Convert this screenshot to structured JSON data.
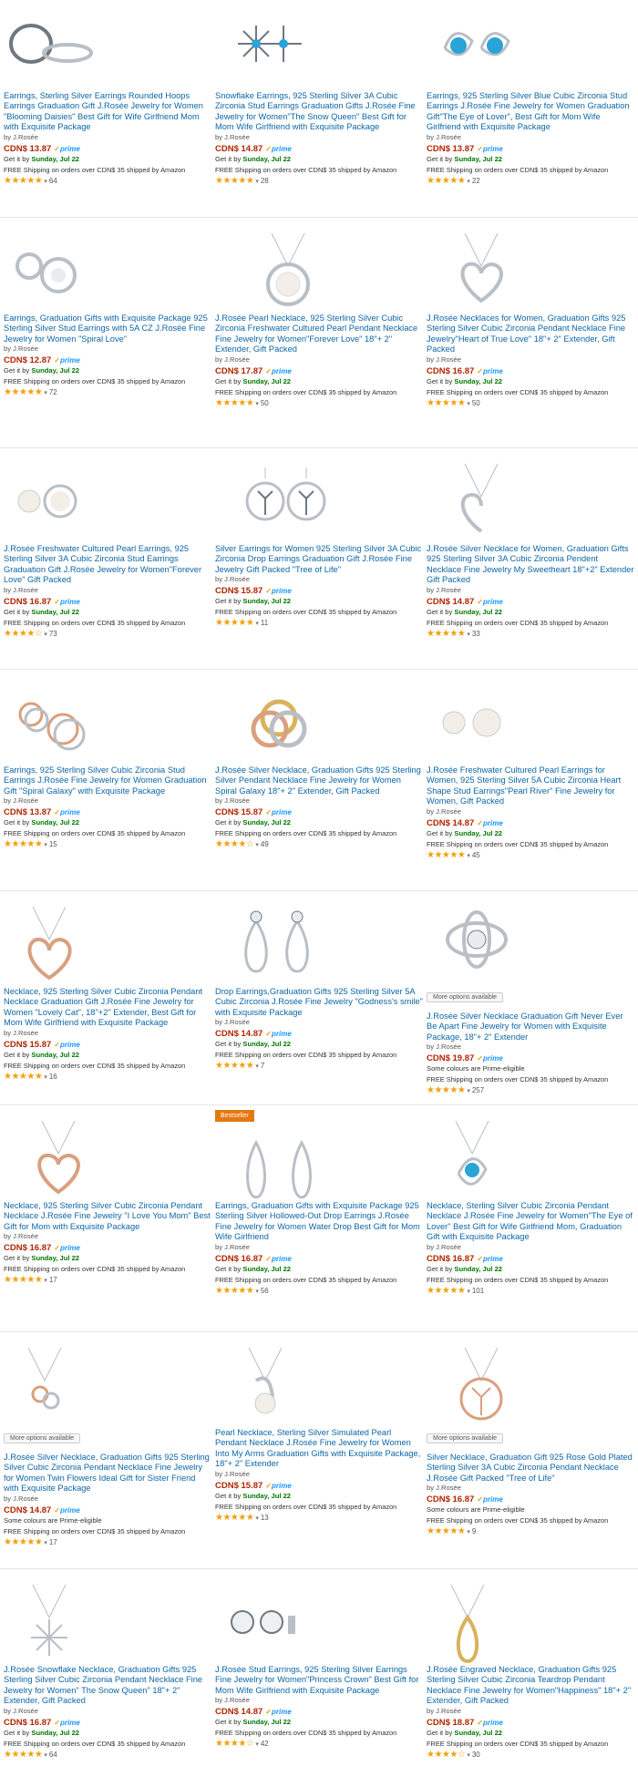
{
  "shared": {
    "by": "by J.Rosée",
    "prime": "prime",
    "get_it_prefix": "Get it by",
    "delivery_date": "Sunday, Jul 22",
    "colours_note": "Some colours are Prime-eligible",
    "shipping": "FREE Shipping on orders over CDN$ 35 shipped by Amazon",
    "more_options": "More options available",
    "bestseller": "Bestseller",
    "star_color": "#f59e0b",
    "link_color": "#0b66a8",
    "price_color": "#b12704"
  },
  "products": [
    {
      "icon": "hoop-earrings",
      "title": "Earrings, Sterling Silver Earrings Rounded Hoops Earrings Graduation Gift J.Rosée Jewelry for Women \"Blooming Daisies\" Best Gift for Wife Girlfriend Mom with Exquisite Package",
      "price": "CDN$ 13.87",
      "stars": "★★★★★",
      "rating": 4.5,
      "reviews": "64",
      "delivery": true
    },
    {
      "icon": "snowflake-earrings",
      "title": "Snowflake Earrings, 925 Sterling Silver 3A Cubic Zirconia Stud Earrings Graduation Gifts J.Rosée Fine Jewelry for Women\"The Snow Queen\" Best Gift for Mom Wife Girlfriend with Exquisite Package",
      "price": "CDN$ 14.87",
      "stars": "★★★★★",
      "rating": 4.5,
      "reviews": "28",
      "delivery": true
    },
    {
      "icon": "blue-zirconia-earrings",
      "title": "Earrings, 925 Sterling Silver Blue Cubic Zirconia Stud Earrings J.Rosée Fine Jewelry for Women Graduation Gift\"The Eye of Lover\", Best Gift for Mom Wife Girlfriend with Exquisite Package",
      "price": "CDN$ 13.87",
      "stars": "★★★★★",
      "rating": 4.5,
      "reviews": "22",
      "delivery": true
    },
    {
      "icon": "swirl-stud-earrings",
      "title": "Earrings, Graduation Gifts with Exquisite Package 925 Sterling Silver Stud Earrings with 5A CZ J.Rosée Fine Jewelry for Women \"Spiral Love\"",
      "price": "CDN$ 12.87",
      "stars": "★★★★★",
      "rating": 4.5,
      "reviews": "72",
      "delivery": true
    },
    {
      "icon": "pearl-pendant",
      "title": "J.Rosée Pearl Necklace, 925 Sterling Silver Cubic Zirconia Freshwater Cultured Pearl Pendant Necklace Fine Jewelry for Women\"Forever Love\" 18\"+ 2\" Extender, Gift Packed",
      "price": "CDN$ 17.87",
      "stars": "★★★★★",
      "rating": 4.5,
      "reviews": "50",
      "delivery": true
    },
    {
      "icon": "heart-pendant",
      "title": "J.Rosée Necklaces for Women, Graduation Gifts 925 Sterling Silver Cubic Zirconia Pendant Necklace Fine Jewelry\"Heart of True Love\" 18\"+ 2\" Extender, Gift Packed",
      "price": "CDN$ 16.87",
      "stars": "★★★★★",
      "rating": 4.5,
      "reviews": "50",
      "delivery": true
    },
    {
      "icon": "pearl-stud-earrings",
      "title": "J.Rosée Freshwater Cultured Pearl Earrings, 925 Sterling Silver 3A Cubic Zirconia Stud Earrings Graduation Gift J.Rosée Jewelry for Women\"Forever Love\" Gift Packed",
      "price": "CDN$ 16.87",
      "stars": "★★★★☆",
      "rating": 4,
      "reviews": "73",
      "delivery": true
    },
    {
      "icon": "tree-drop-earrings",
      "title": "Silver Earrings for Women 925 Sterling Silver 3A Cubic Zirconia Drop Earrings Graduation Gift J.Rosée Fine Jewelry Gift Packed \"Tree of Life\"",
      "price": "CDN$ 15.87",
      "stars": "★★★★★",
      "rating": 4.5,
      "reviews": "11",
      "delivery": true
    },
    {
      "icon": "heart-outline-pendant",
      "title": "J.Rosée Silver Necklace for Women, Graduation Gifts 925 Sterling Silver 3A Cubic Zirconia Pendent Necklace Fine Jewelry My Sweetheart 18\"+2\" Extender Gift Packed",
      "price": "CDN$ 14.87",
      "stars": "★★★★★",
      "rating": 4.5,
      "reviews": "33",
      "delivery": true
    },
    {
      "icon": "knot-stud-earrings",
      "title": "Earrings, 925 Sterling Silver Cubic Zirconia Stud Earrings J.Rosée Fine Jewelry for Women Graduation Gift \"Spiral Galaxy\" with Exquisite Package",
      "price": "CDN$ 13.87",
      "stars": "★★★★★",
      "rating": 5,
      "reviews": "15",
      "delivery": true
    },
    {
      "icon": "tricolor-knot-pendant",
      "title": "J.Rosée Silver Necklace, Graduation Gifts 925 Sterling Silver Pendant Necklace Fine Jewelry for Women Spiral Galaxy 18\"+ 2\" Extender, Gift Packed",
      "price": "CDN$ 15.87",
      "stars": "★★★★☆",
      "rating": 4,
      "reviews": "49",
      "delivery": true
    },
    {
      "icon": "pearl-heart-earrings",
      "title": "J.Rosée Freshwater Cultured Pearl Earrings for Women, 925 Sterling Silver 5A Cubic Zirconia Heart Shape Stud Earrings\"Pearl River\" Fine Jewelry for Women, Gift Packed",
      "price": "CDN$ 14.87",
      "stars": "★★★★★",
      "rating": 4.5,
      "reviews": "45",
      "delivery": true
    },
    {
      "icon": "rose-heart-pendant",
      "title": "Necklace, 925 Sterling Silver Cubic Zirconia Pendant Necklace Graduation Gift J.Rosée Fine Jewelry for Women \"Lovely Cat\", 18\"+2\" Extender, Best Gift for Mom Wife Girlfriend with Exquisite Package",
      "price": "CDN$ 15.87",
      "stars": "★★★★★",
      "rating": 4.5,
      "reviews": "16",
      "delivery": true
    },
    {
      "icon": "teardrop-earrings",
      "title": "Drop Earrings,Graduation Gifts 925 Sterling Silver 5A Cubic Zirconia J.Rosée Fine Jewelry \"Godness's smile\" with Exquisite Package",
      "price": "CDN$ 14.87",
      "stars": "★★★★★",
      "rating": 5,
      "reviews": "7",
      "delivery": true
    },
    {
      "icon": "orbit-pendant",
      "title": "J.Rosée Silver Necklace Graduation Gift Never Ever Be Apart Fine Jewelry for Women with Exquisite Package, 18\"+ 2\" Extender",
      "price": "CDN$ 19.87",
      "stars": "★★★★★",
      "rating": 4.5,
      "reviews": "257",
      "delivery": false,
      "colours": true,
      "more_options": true
    },
    {
      "icon": "i-love-you-mom-pendant",
      "title": "Necklace, 925 Sterling Silver Cubic Zirconia Pendant Necklace J.Rosée Fine Jewelry \"I Love You Mom\" Best Gift for Mom with Exquisite Package",
      "price": "CDN$ 16.87",
      "stars": "★★★★★",
      "rating": 4.5,
      "reviews": "17",
      "delivery": true
    },
    {
      "icon": "hollow-drop-earrings",
      "title": "Earrings, Graduation Gifts with Exquisite Package 925 Sterling Silver Hollowed-Out Drop Earrings J.Rosée Fine Jewelry for Women Water Drop Best Gift for Mom Wife Girlfriend",
      "price": "CDN$ 16.87",
      "stars": "★★★★★",
      "rating": 4.5,
      "reviews": "56",
      "delivery": true,
      "bestseller": true
    },
    {
      "icon": "blue-eye-pendant",
      "title": "Necklace, Sterling Silver Cubic Zirconia Pendant Necklace J.Rosée Fine Jewelry for Women\"The Eye of Lover\" Best Gift for Wife Girlfriend Mom, Graduation Gift with Exquisite Package",
      "price": "CDN$ 16.87",
      "stars": "★★★★★",
      "rating": 4.5,
      "reviews": "101",
      "delivery": true
    },
    {
      "icon": "twin-flowers-pendant",
      "title": "J.Rosée Silver Necklace, Graduation Gifts 925 Sterling Silver Cubic Zirconia Pendant Necklace Fine Jewelry for Women Twin Flowers Ideal Gift for Sister Friend with Exquisite Package",
      "price": "CDN$ 14.87",
      "stars": "★★★★★",
      "rating": 4.5,
      "reviews": "17",
      "delivery": false,
      "colours": true,
      "more_options": true
    },
    {
      "icon": "pearl-wing-pendant",
      "title": "Pearl Necklace, Sterling Silver Simulated Pearl Pendant Necklace J.Rosée Fine Jewelry for Women Into My Arms Graduation Gifts with Exquisite Package, 18\"+ 2\" Extender",
      "price": "CDN$ 15.87",
      "stars": "★★★★★",
      "rating": 4.5,
      "reviews": "13",
      "delivery": true
    },
    {
      "icon": "rose-tree-pendant",
      "title": "Silver Necklace, Graduation Gift 925 Rose Gold Plated Sterling Silver 3A Cubic Zirconia Pendant Necklace J.Rosée Gift Packed \"Tree of Life\"",
      "price": "CDN$ 16.87",
      "stars": "★★★★★",
      "rating": 4.5,
      "reviews": "9",
      "delivery": false,
      "colours": true,
      "more_options": true
    },
    {
      "icon": "snowflake-pendant",
      "title": "J.Rosée Snowflake Necklace, Graduation Gifts 925 Sterling Silver Cubic Zirconia Pendant Necklace Fine Jewelry for Women\" The Snow Queen\" 18\"+ 2\" Extender, Gift Packed",
      "price": "CDN$ 16.87",
      "stars": "★★★★★",
      "rating": 4.5,
      "reviews": "64",
      "delivery": true
    },
    {
      "icon": "crown-stud-earrings",
      "title": "J.Rosée Stud Earrings, 925 Sterling Silver Earrings Fine Jewelry for Women\"Princess Crown\" Best Gift for Mom Wife Girlfriend with Exquisite Package",
      "price": "CDN$ 14.87",
      "stars": "★★★★☆",
      "rating": 4,
      "reviews": "42",
      "delivery": true
    },
    {
      "icon": "engraved-teardrop-pendant",
      "title": "J.Rosée Engraved Necklace, Graduation Gifts 925 Sterling Silver Cubic Zirconia Teardrop Pendant Necklace Fine Jewelry for Women\"Happiness\" 18\"+ 2\" Extender, Gift Packed",
      "price": "CDN$ 18.87",
      "stars": "★★★★☆",
      "rating": 4,
      "reviews": "30",
      "delivery": true
    }
  ]
}
